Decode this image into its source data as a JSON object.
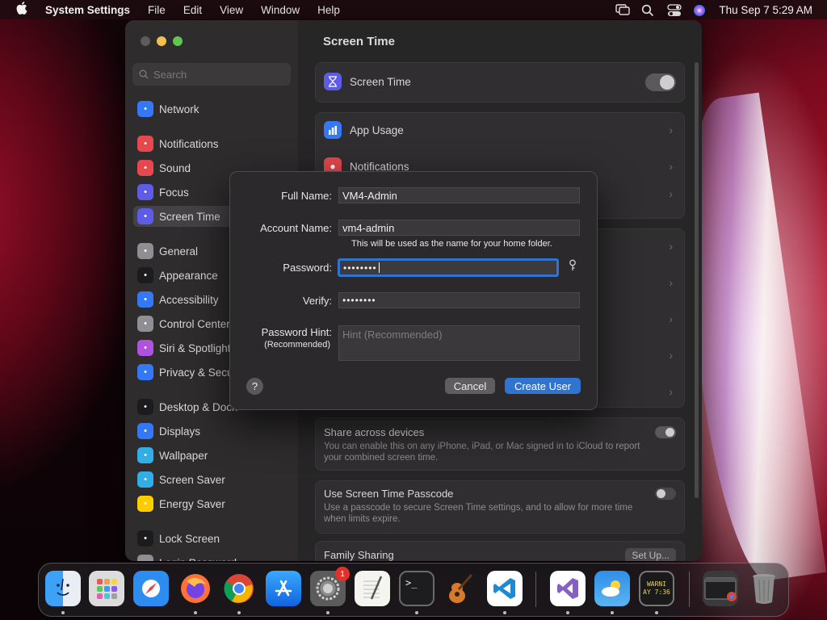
{
  "menubar": {
    "app_name": "System Settings",
    "menus": [
      "File",
      "Edit",
      "View",
      "Window",
      "Help"
    ],
    "clock": "Thu Sep 7  5:29 AM"
  },
  "sidebar": {
    "search_placeholder": "Search",
    "items": [
      {
        "label": "Network",
        "icon": "globe-icon",
        "color": "#3478f6"
      },
      {
        "label": "Notifications",
        "icon": "bell-icon",
        "color": "#e5484d"
      },
      {
        "label": "Sound",
        "icon": "speaker-icon",
        "color": "#e5484d"
      },
      {
        "label": "Focus",
        "icon": "moon-icon",
        "color": "#5e5ce6"
      },
      {
        "label": "Screen Time",
        "icon": "hourglass-icon",
        "color": "#5e5ce6"
      },
      {
        "label": "General",
        "icon": "gear-icon",
        "color": "#8e8e93"
      },
      {
        "label": "Appearance",
        "icon": "circle-half-icon",
        "color": "#1c1c1e"
      },
      {
        "label": "Accessibility",
        "icon": "accessibility-icon",
        "color": "#3478f6"
      },
      {
        "label": "Control Center",
        "icon": "control-center-icon",
        "color": "#8e8e93"
      },
      {
        "label": "Siri & Spotlight",
        "icon": "siri-icon",
        "color": "#af52de"
      },
      {
        "label": "Privacy & Security",
        "icon": "hand-icon",
        "color": "#3478f6"
      },
      {
        "label": "Desktop & Dock",
        "icon": "dock-icon",
        "color": "#1c1c1e"
      },
      {
        "label": "Displays",
        "icon": "sun-icon",
        "color": "#3478f6"
      },
      {
        "label": "Wallpaper",
        "icon": "wallpaper-icon",
        "color": "#32ade6"
      },
      {
        "label": "Screen Saver",
        "icon": "screensaver-icon",
        "color": "#32ade6"
      },
      {
        "label": "Energy Saver",
        "icon": "battery-icon",
        "color": "#ffcc00"
      },
      {
        "label": "Lock Screen",
        "icon": "lock-icon",
        "color": "#1c1c1e"
      },
      {
        "label": "Login Password",
        "icon": "key-icon",
        "color": "#8e8e93"
      }
    ]
  },
  "content": {
    "title": "Screen Time",
    "screen_time_row": "Screen Time",
    "app_usage": "App Usage",
    "notifications": "Notifications",
    "share": {
      "title": "Share across devices",
      "desc": "You can enable this on any iPhone, iPad, or Mac signed in to iCloud to report your combined screen time."
    },
    "passcode": {
      "title": "Use Screen Time Passcode",
      "desc": "Use a passcode to secure Screen Time settings, and to allow for more time when limits expire."
    },
    "family": {
      "title": "Family Sharing",
      "button": "Set Up..."
    }
  },
  "dialog": {
    "full_name_label": "Full Name:",
    "full_name_value": "VM4-Admin",
    "account_name_label": "Account Name:",
    "account_name_value": "vm4-admin",
    "account_hint": "This will be used as the name for your home folder.",
    "password_label": "Password:",
    "password_value": "••••••••",
    "verify_label": "Verify:",
    "verify_value": "••••••••",
    "hint_label": "Password Hint:",
    "hint_label_sub": "(Recommended)",
    "hint_placeholder": "Hint (Recommended)",
    "help_label": "?",
    "cancel": "Cancel",
    "create": "Create User",
    "accent_color": "#2f74d0"
  },
  "dock": {
    "apps": [
      {
        "name": "Finder",
        "icon": "finder-icon"
      },
      {
        "name": "Launchpad",
        "icon": "launchpad-icon"
      },
      {
        "name": "Safari",
        "icon": "safari-icon"
      },
      {
        "name": "Firefox",
        "icon": "firefox-icon"
      },
      {
        "name": "Chrome",
        "icon": "chrome-icon"
      },
      {
        "name": "App Store",
        "icon": "app-store-icon"
      },
      {
        "name": "System Settings",
        "icon": "system-settings-icon",
        "badge": "1"
      },
      {
        "name": "TextEdit",
        "icon": "textedit-icon"
      },
      {
        "name": "Terminal",
        "icon": "terminal-icon"
      },
      {
        "name": "GarageBand",
        "icon": "garageband-icon"
      },
      {
        "name": "Visual Studio Code",
        "icon": "vscode-icon"
      },
      {
        "name": "Visual Studio",
        "icon": "visual-studio-icon"
      },
      {
        "name": "Weather",
        "icon": "weather-icon"
      },
      {
        "name": "Console",
        "icon": "console-icon"
      },
      {
        "name": "Chrome Window",
        "icon": "chrome-window-icon"
      },
      {
        "name": "Trash",
        "icon": "trash-icon"
      }
    ],
    "console_text": "WARNI\nAY 7:36",
    "terminal_text": ">_"
  }
}
